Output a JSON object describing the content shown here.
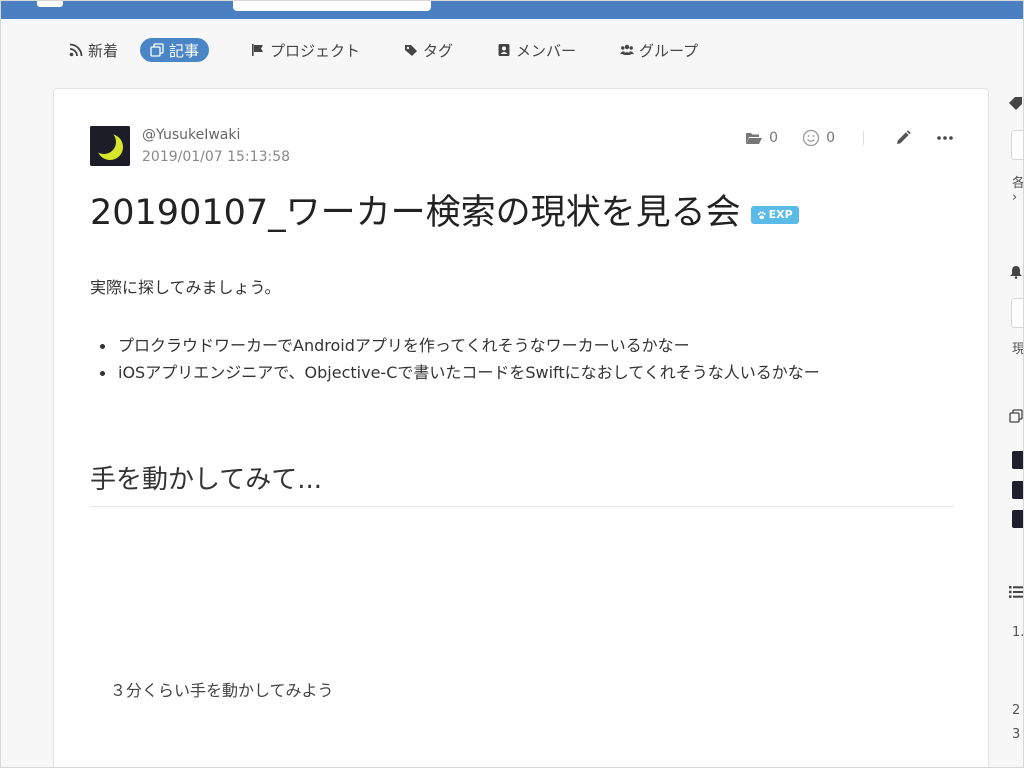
{
  "nav": {
    "items": [
      {
        "label": "新着",
        "icon": "rss-icon"
      },
      {
        "label": "記事",
        "icon": "articles-icon",
        "active": true
      },
      {
        "label": "プロジェクト",
        "icon": "flag-icon"
      },
      {
        "label": "タグ",
        "icon": "tags-icon"
      },
      {
        "label": "メンバー",
        "icon": "member-card-icon"
      },
      {
        "label": "グループ",
        "icon": "users-icon"
      }
    ]
  },
  "article": {
    "author": "@YusukeIwaki",
    "timestamp": "2019/01/07 15:13:58",
    "stocks_count": "0",
    "likes_count": "0",
    "title": "20190107_ワーカー検索の現状を見る会",
    "badge": "EXP",
    "intro": "実際に探してみましょう。",
    "bullets": [
      "プロクラウドワーカーでAndroidアプリを作ってくれそうなワーカーいるかなー",
      "iOSアプリエンジニアで、Objective-Cで書いたコードをSwiftになおしてくれそうな人いるかなー"
    ],
    "section_heading": "手を動かしてみて...",
    "note": "３分くらい手を動かしてみよう"
  },
  "sidebar": {
    "texts": [
      "各",
      "›",
      "現",
      "1.",
      "2",
      "3"
    ]
  },
  "colors": {
    "topbar": "#4a7fc1",
    "nav_active": "#4a86c5",
    "badge": "#5bbbe8"
  }
}
